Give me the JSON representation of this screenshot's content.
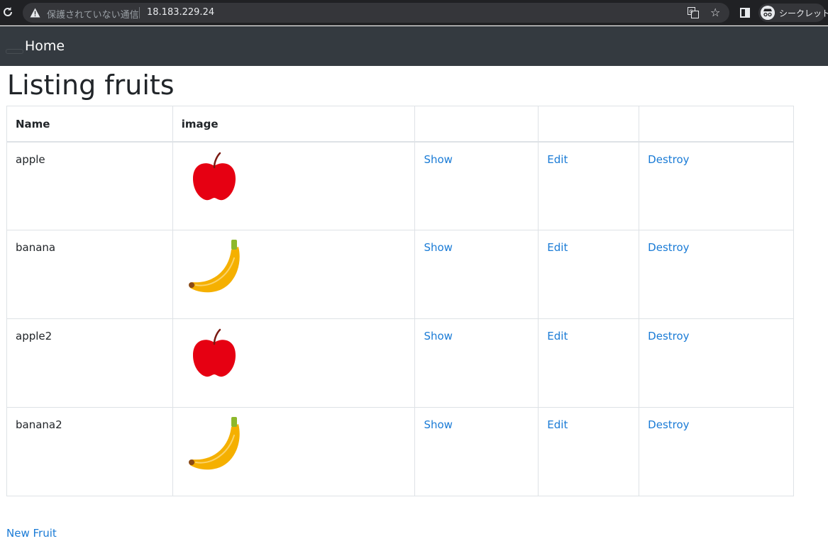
{
  "browser": {
    "security_label": "保護されていない通信",
    "url": "18.183.229.24",
    "incognito_label": "シークレット"
  },
  "navbar": {
    "brand": "Home"
  },
  "page": {
    "title": "Listing fruits",
    "new_link": "New Fruit"
  },
  "table": {
    "headers": [
      "Name",
      "image",
      "",
      "",
      ""
    ],
    "rows": [
      {
        "name": "apple",
        "image": "apple-image",
        "show": "Show",
        "edit": "Edit",
        "destroy": "Destroy"
      },
      {
        "name": "banana",
        "image": "banana-image",
        "show": "Show",
        "edit": "Edit",
        "destroy": "Destroy"
      },
      {
        "name": "apple2",
        "image": "apple-image",
        "show": "Show",
        "edit": "Edit",
        "destroy": "Destroy"
      },
      {
        "name": "banana2",
        "image": "banana-image",
        "show": "Show",
        "edit": "Edit",
        "destroy": "Destroy"
      }
    ]
  },
  "colors": {
    "navbar": "#343a40",
    "link": "#1a7bd6",
    "apple": "#e60012",
    "banana": "#f5b000"
  }
}
